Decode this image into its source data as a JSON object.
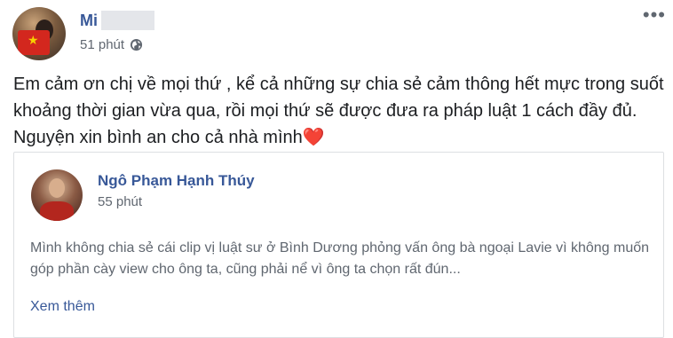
{
  "post": {
    "author_name": "Mi",
    "time": "51 phút",
    "privacy_icon": "globe-icon",
    "more_icon": "more-horizontal-icon",
    "text": "Em cảm ơn chị về mọi thứ , kể cả những sự chia sẻ cảm thông hết mực trong suốt khoảng thời gian vừa qua, rồi mọi thứ sẽ được đưa ra pháp luật 1 cách đầy đủ. Nguyện xin bình an cho cả nhà mình",
    "emoji": "❤️"
  },
  "shared_post": {
    "author_name": "Ngô Phạm Hạnh Thúy",
    "time": "55 phút",
    "text": "Mình không chia sẻ cái clip vị luật sư ở Bình Dương phỏng vấn ông bà ngoại Lavie vì không muốn góp phần cày view cho ông ta, cũng phải nể vì ông ta chọn rất đún...",
    "see_more_label": "Xem thêm"
  },
  "colors": {
    "link_blue": "#385898",
    "secondary_gray": "#606770",
    "primary_text": "#1c1e21",
    "heart_red": "#e0245e",
    "border": "#dddfe2"
  }
}
